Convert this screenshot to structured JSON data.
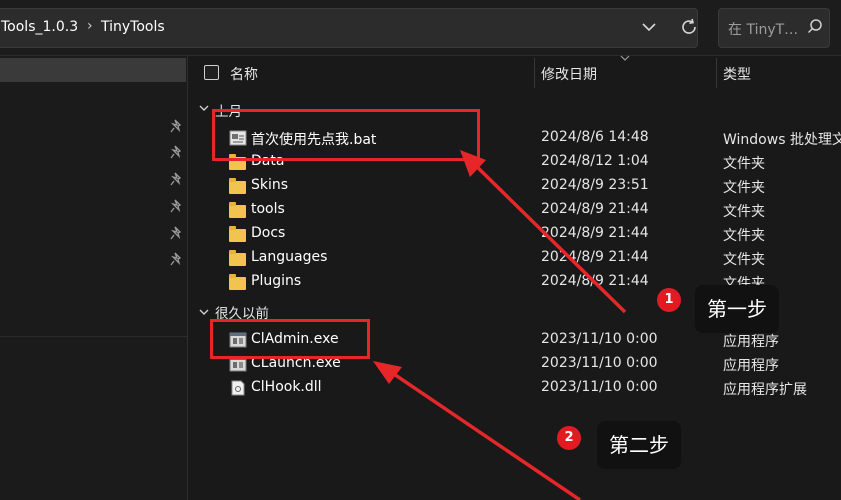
{
  "address_bar": {
    "crumbs": [
      "Tools_1.0.3",
      "TinyTools"
    ],
    "separator": "›"
  },
  "search": {
    "placeholder": "在 TinyT…"
  },
  "columns": {
    "name": "名称",
    "date": "修改日期",
    "type": "类型"
  },
  "groups": [
    {
      "label": "上月",
      "items": [
        {
          "name": "首次使用先点我.bat",
          "date": "2024/8/6 14:48",
          "type": "Windows 批处理文",
          "icon": "batch-file-icon"
        },
        {
          "name": "Data",
          "date": "2024/8/12 1:04",
          "type": "文件夹",
          "icon": "folder-icon"
        },
        {
          "name": "Skins",
          "date": "2024/8/9 23:51",
          "type": "文件夹",
          "icon": "folder-icon"
        },
        {
          "name": "tools",
          "date": "2024/8/9 21:44",
          "type": "文件夹",
          "icon": "folder-icon"
        },
        {
          "name": "Docs",
          "date": "2024/8/9 21:44",
          "type": "文件夹",
          "icon": "folder-icon"
        },
        {
          "name": "Languages",
          "date": "2024/8/9 21:44",
          "type": "文件夹",
          "icon": "folder-icon"
        },
        {
          "name": "Plugins",
          "date": "2024/8/9 21:44",
          "type": "文件夹",
          "icon": "folder-icon"
        }
      ]
    },
    {
      "label": "很久以前",
      "items": [
        {
          "name": "ClAdmin.exe",
          "date": "2023/11/10 0:00",
          "type": "应用程序",
          "icon": "exe-icon"
        },
        {
          "name": "CLaunch.exe",
          "date": "2023/11/10 0:00",
          "type": "应用程序",
          "icon": "exe-icon"
        },
        {
          "name": "ClHook.dll",
          "date": "2023/11/10 0:00",
          "type": "应用程序扩展",
          "icon": "dll-icon"
        }
      ]
    }
  ],
  "annotations": {
    "step1": {
      "number": "1",
      "label": "第一步"
    },
    "step2": {
      "number": "2",
      "label": "第二步"
    },
    "color": "#e7262a"
  }
}
